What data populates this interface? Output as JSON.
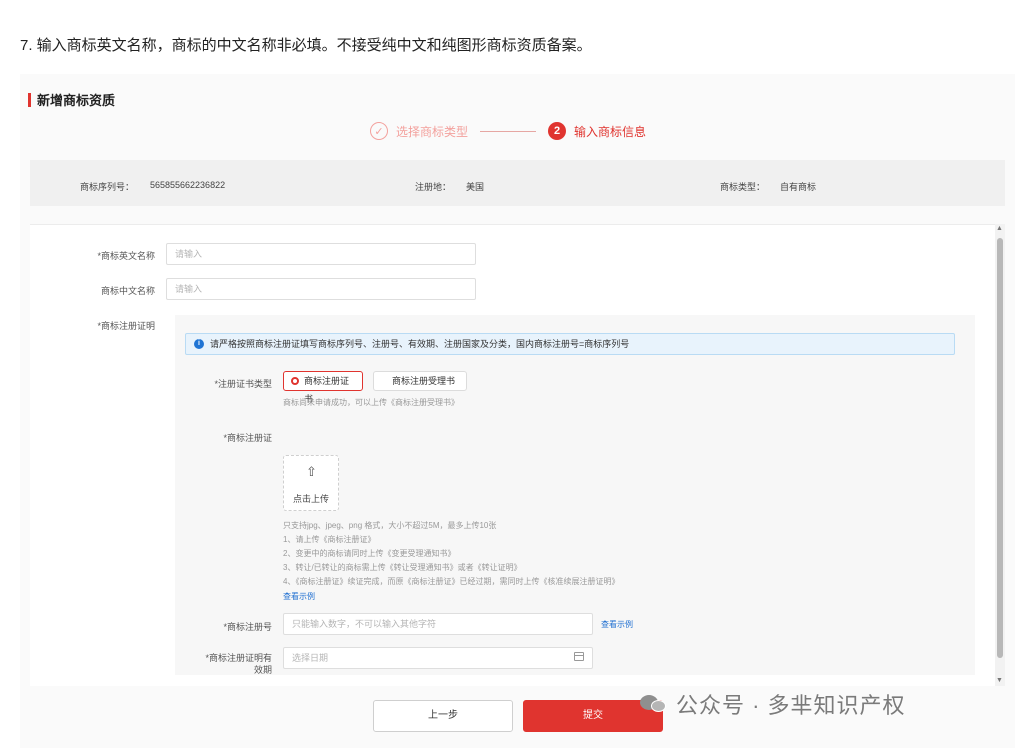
{
  "instruction": "7. 输入商标英文名称，商标的中文名称非必填。不接受纯中文和纯图形商标资质备案。",
  "dialog": {
    "title": "新增商标资质",
    "steps": [
      {
        "label": "选择商标类型",
        "status": "done"
      },
      {
        "number": "2",
        "label": "输入商标信息",
        "status": "active"
      }
    ]
  },
  "info_bar": {
    "serial_label": "商标序列号：",
    "serial_value": "565855662236822",
    "region_label": "注册地：",
    "region_value": "美国",
    "type_label": "商标类型：",
    "type_value": "自有商标"
  },
  "form": {
    "english_name": {
      "label": "*商标英文名称",
      "placeholder": "请输入"
    },
    "chinese_name": {
      "label": "商标中文名称",
      "placeholder": "请输入"
    },
    "certificate_section_label": "*商标注册证明",
    "notice": "请严格按照商标注册证填写商标序列号、注册号、有效期、注册国家及分类，国内商标注册号=商标序列号",
    "cert_type": {
      "label": "*注册证书类型",
      "options": [
        "商标注册证书",
        "商标注册受理书"
      ],
      "selected": "商标注册证书",
      "hint": "商标尚未申请成功，可以上传《商标注册受理书》"
    },
    "cert_upload": {
      "label": "*商标注册证",
      "upload_text": "点击上传",
      "rules": [
        "只支持jpg、jpeg、png 格式，大小不超过5M，最多上传10张",
        "1、请上传《商标注册证》",
        "2、变更中的商标请同时上传《变更受理通知书》",
        "3、转让/已转让的商标需上传《转让受理通知书》或者《转让证明》",
        "4、《商标注册证》续证完成，而原《商标注册证》已经过期，需同时上传《核准续展注册证明》"
      ],
      "example_link": "查看示例"
    },
    "reg_number": {
      "label": "*商标注册号",
      "placeholder": "只能输入数字，不可以输入其他字符",
      "example_link": "查看示例"
    },
    "validity": {
      "label_line1": "*商标注册证明有",
      "label_line2": "效期",
      "placeholder": "选择日期"
    }
  },
  "buttons": {
    "prev": "上一步",
    "submit": "提交"
  },
  "watermark": "公众号 · 多芈知识产权"
}
